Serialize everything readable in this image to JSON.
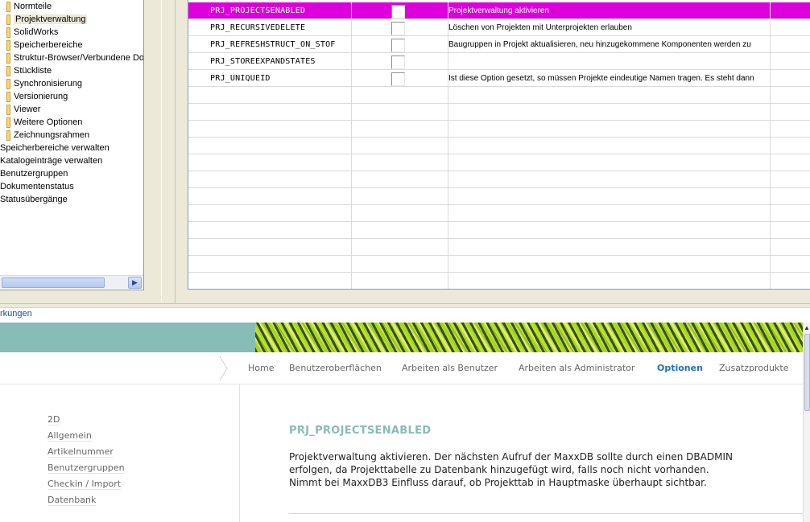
{
  "tree": {
    "items": [
      {
        "label": "Normteile",
        "level": 1
      },
      {
        "label": "Projektverwaltung",
        "level": 1,
        "selected": true
      },
      {
        "label": "SolidWorks",
        "level": 1
      },
      {
        "label": "Speicherbereiche",
        "level": 1
      },
      {
        "label": "Struktur-Browser/Verbundene Do",
        "level": 1
      },
      {
        "label": "Stückliste",
        "level": 1
      },
      {
        "label": "Synchronisierung",
        "level": 1
      },
      {
        "label": "Versionierung",
        "level": 1
      },
      {
        "label": "Viewer",
        "level": 1
      },
      {
        "label": "Weitere Optionen",
        "level": 1
      },
      {
        "label": "Zeichnungsrahmen",
        "level": 1
      },
      {
        "label": "Speicherbereiche verwalten",
        "level": 0
      },
      {
        "label": "Katalogeinträge verwalten",
        "level": 0
      },
      {
        "label": "Benutzergruppen",
        "level": 0
      },
      {
        "label": "Dokumentenstatus",
        "level": 0
      },
      {
        "label": "Statusübergänge",
        "level": 0
      }
    ]
  },
  "grid": {
    "rows": [
      {
        "name": "PRJ_PROJECTSENABLED",
        "checked": false,
        "description": "Projektverwaltung aktivieren",
        "selected": true
      },
      {
        "name": "PRJ_RECURSIVEDELETE",
        "checked": false,
        "description": "Löschen von Projekten mit Unterprojekten erlauben"
      },
      {
        "name": "PRJ_REFRESHSTRUCT_ON_STOF",
        "checked": false,
        "description": "Baugruppen in Projekt aktualisieren, neu hinzugekommene Komponenten werden zu"
      },
      {
        "name": "PRJ_STOREEXPANDSTATES",
        "checked": false,
        "description": ""
      },
      {
        "name": "PRJ_UNIQUEID",
        "checked": false,
        "description": "Ist diese Option gesetzt, so müssen Projekte eindeutige Namen tragen. Es steht dann"
      }
    ],
    "selected_color": "#dd00dd"
  },
  "help": {
    "link_text": "rkungen",
    "nav": [
      {
        "label": "Home"
      },
      {
        "label": "Benutzeroberflächen"
      },
      {
        "label": "Arbeiten als Benutzer"
      },
      {
        "label": "Arbeiten als Administrator"
      },
      {
        "label": "Optionen",
        "active": true
      },
      {
        "label": "Zusatzprodukte"
      }
    ],
    "sidebar": [
      "2D",
      "Allgemein",
      "Artikelnummer",
      "Benutzergruppen",
      "Checkin / Import",
      "Datenbank"
    ],
    "title": "PRJ_PROJECTSENABLED",
    "body_lines": [
      "Projektverwaltung aktivieren. Der nächsten Aufruf der MaxxDB sollte durch einen DBADMIN",
      "erfolgen, da Projekttabelle zu Datenbank hinzugefügt wird, falls noch nicht vorhanden.",
      "Nimmt bei MaxxDB3 Einfluss darauf, ob Projekttab in Hauptmaske überhaupt sichtbar."
    ],
    "accent_color": "#88bcb6",
    "active_nav_color": "#1f72c0"
  },
  "icons": {
    "tree_folder": "folder-icon",
    "scroll_right": "arrow-right-icon",
    "nav_separator": "chevron-right-icon",
    "scroll_up": "arrow-up-icon"
  }
}
